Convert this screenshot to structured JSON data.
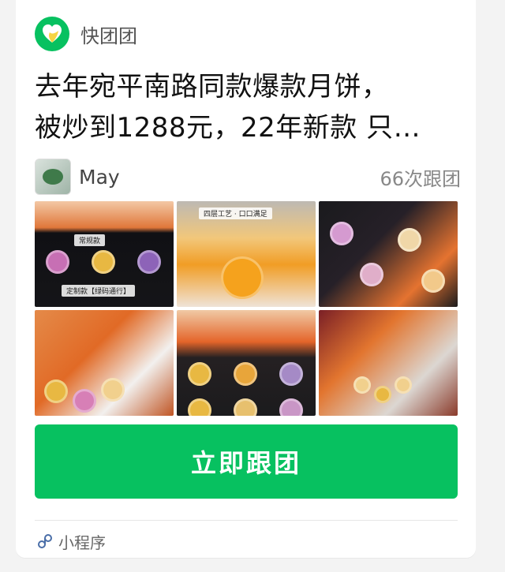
{
  "source": {
    "app_name": "快团团",
    "logo_icon": "heart-icon",
    "brand_color": "#07c160"
  },
  "post": {
    "title_line1": "去年宛平南路同款爆款月饼，",
    "title_line2": "被炒到1288元，22年新款 只…"
  },
  "author": {
    "name": "May",
    "follow_count": "66次跟团"
  },
  "gallery": {
    "p1_label_top": "常规款",
    "p1_label_bottom": "定制款【绿码通行】",
    "p2_label": "四层工艺 · 口口满足"
  },
  "cta": {
    "label": "立即跟团",
    "color": "#07c160"
  },
  "footer": {
    "icon": "mini-program-icon",
    "label": "小程序"
  }
}
